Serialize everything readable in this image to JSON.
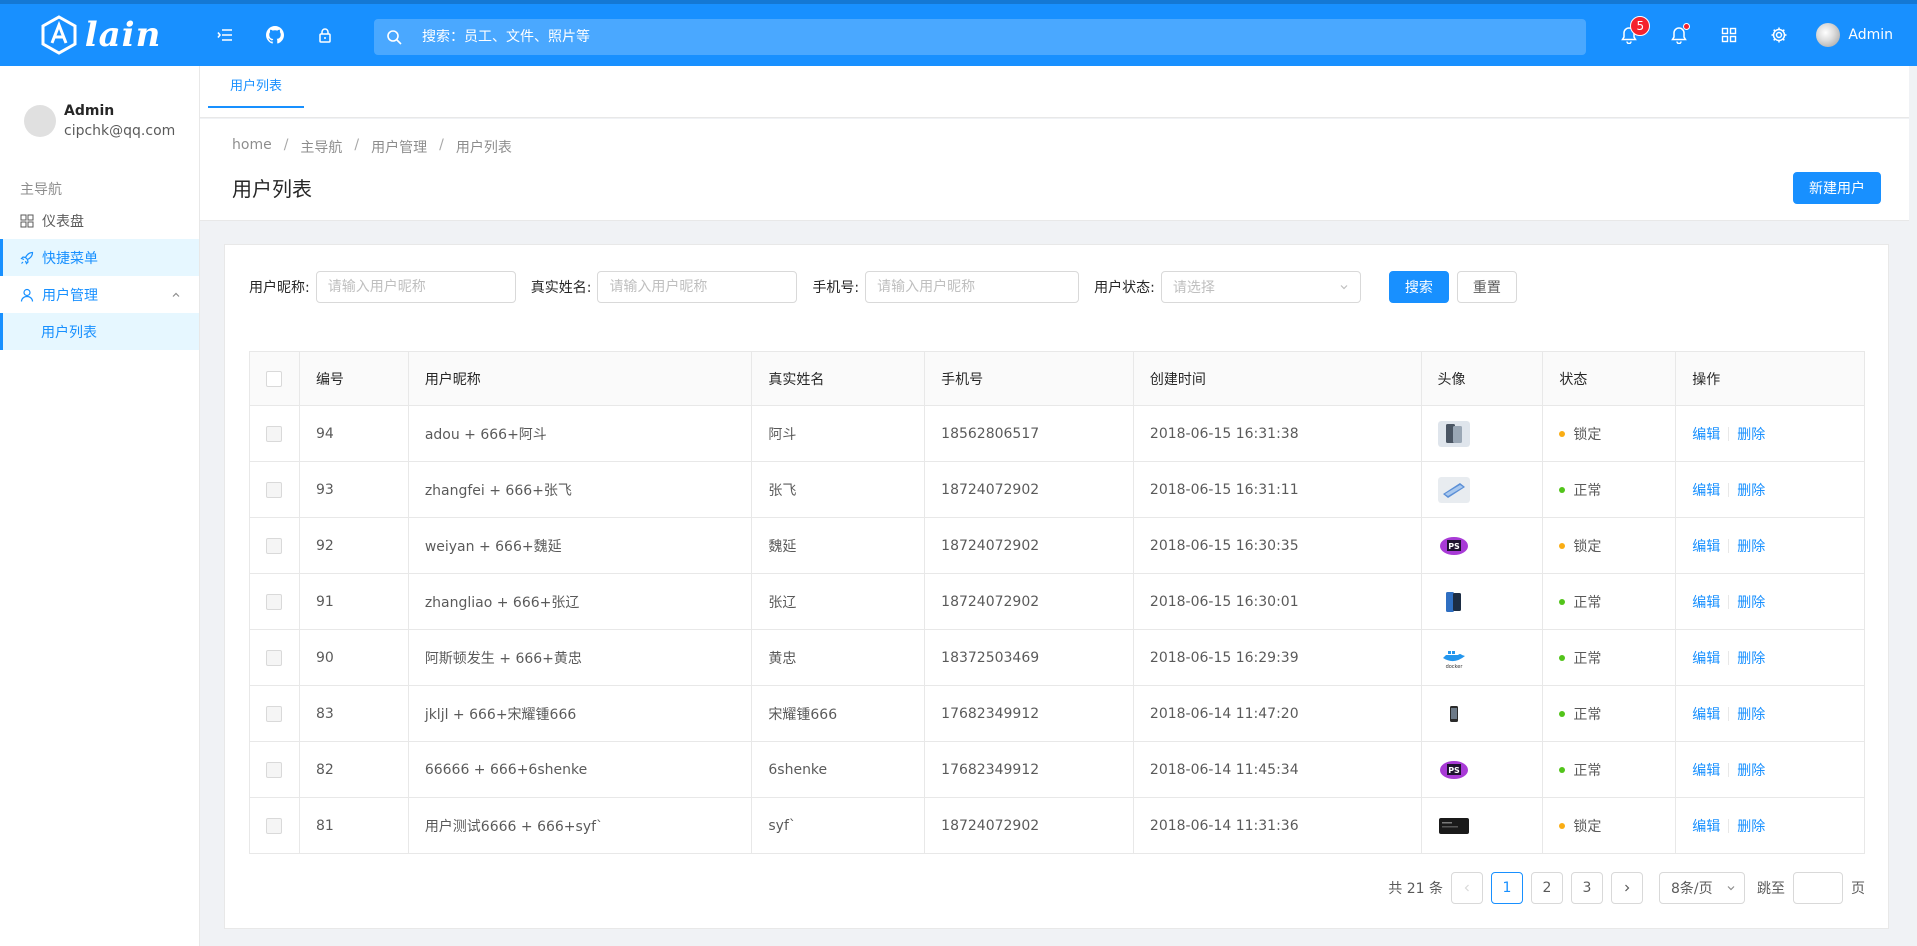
{
  "header": {
    "logo_text": "lain",
    "search_placeholder": "搜索：员工、文件、照片等",
    "notification_count": "5",
    "user_name": "Admin"
  },
  "sidebar": {
    "user_name": "Admin",
    "user_email": "cipchk@qq.com",
    "group_title": "主导航",
    "items": [
      {
        "label": "仪表盘",
        "icon": "dashboard-icon"
      },
      {
        "label": "快捷菜单",
        "icon": "rocket-icon"
      },
      {
        "label": "用户管理",
        "icon": "user-icon"
      }
    ],
    "sub_item": "用户列表"
  },
  "tabs": {
    "active": "用户列表"
  },
  "breadcrumb": [
    "home",
    "主导航",
    "用户管理",
    "用户列表"
  ],
  "page_title": "用户列表",
  "new_user_button": "新建用户",
  "filters": {
    "nickname_label": "用户昵称:",
    "nickname_placeholder": "请输入用户昵称",
    "realname_label": "真实姓名:",
    "realname_placeholder": "请输入用户昵称",
    "phone_label": "手机号:",
    "phone_placeholder": "请输入用户昵称",
    "status_label": "用户状态:",
    "status_placeholder": "请选择",
    "search_button": "搜索",
    "reset_button": "重置"
  },
  "table": {
    "columns": [
      "编号",
      "用户昵称",
      "真实姓名",
      "手机号",
      "创建时间",
      "头像",
      "状态",
      "操作"
    ],
    "action_edit": "编辑",
    "action_delete": "删除",
    "rows": [
      {
        "id": "94",
        "nickname": "adou + 666+阿斗",
        "realname": "阿斗",
        "phone": "18562806517",
        "created": "2018-06-15 16:31:38",
        "avatar": "phone",
        "status": "锁定"
      },
      {
        "id": "93",
        "nickname": "zhangfei + 666+张飞",
        "realname": "张飞",
        "phone": "18724072902",
        "created": "2018-06-15 16:31:11",
        "avatar": "phone-flat",
        "status": "正常"
      },
      {
        "id": "92",
        "nickname": "weiyan + 666+魏延",
        "realname": "魏延",
        "phone": "18724072902",
        "created": "2018-06-15 16:30:35",
        "avatar": "ps",
        "status": "锁定"
      },
      {
        "id": "91",
        "nickname": "zhangliao + 666+张辽",
        "realname": "张辽",
        "phone": "18724072902",
        "created": "2018-06-15 16:30:01",
        "avatar": "phone-blue",
        "status": "正常"
      },
      {
        "id": "90",
        "nickname": "阿斯顿发生 + 666+黄忠",
        "realname": "黄忠",
        "phone": "18372503469",
        "created": "2018-06-15 16:29:39",
        "avatar": "docker",
        "status": "正常"
      },
      {
        "id": "83",
        "nickname": "jkljl + 666+宋耀锺666",
        "realname": "宋耀锺666",
        "phone": "17682349912",
        "created": "2018-06-14 11:47:20",
        "avatar": "phone-dark",
        "status": "正常"
      },
      {
        "id": "82",
        "nickname": "66666 + 666+6shenke",
        "realname": "6shenke",
        "phone": "17682349912",
        "created": "2018-06-14 11:45:34",
        "avatar": "ps",
        "status": "正常"
      },
      {
        "id": "81",
        "nickname": "用户测试6666 + 666+syf`",
        "realname": "syf`",
        "phone": "18724072902",
        "created": "2018-06-14 11:31:36",
        "avatar": "terminal",
        "status": "锁定"
      }
    ]
  },
  "status_colors": {
    "锁定": "#faad14",
    "正常": "#52c41a"
  },
  "pagination": {
    "total": "共 21 条",
    "pages": [
      "1",
      "2",
      "3"
    ],
    "current": "1",
    "page_size": "8条/页",
    "jump_label": "跳至",
    "page_suffix": "页"
  },
  "colors": {
    "primary": "#1890ff"
  }
}
